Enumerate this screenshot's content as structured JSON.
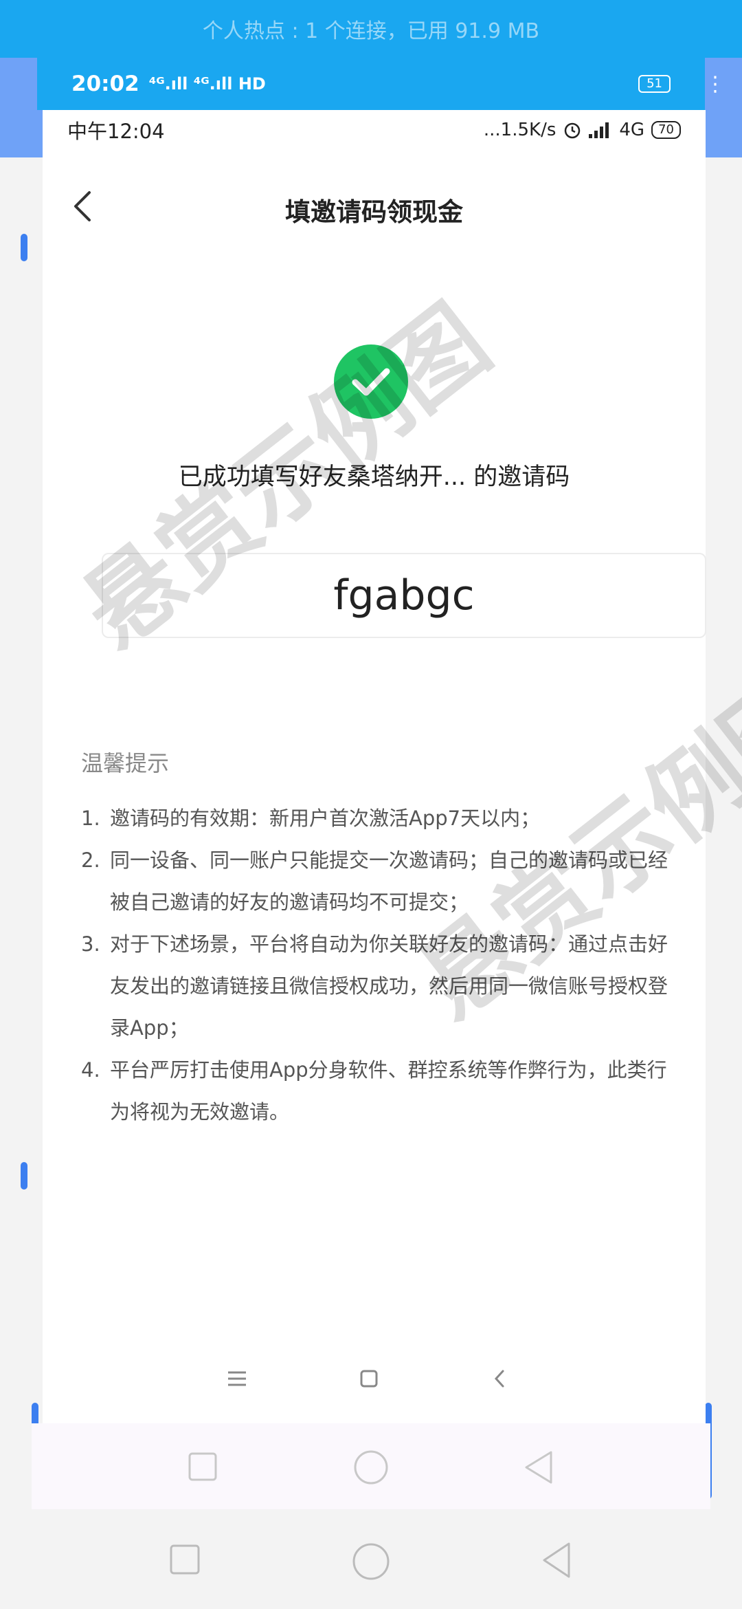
{
  "outer_status": {
    "hotspot_text": "个人热点 : 1 个连接，已用 91.9 MB"
  },
  "middle_status": {
    "time": "20:02",
    "signal_text": "⁴ᴳ.ıll ⁴ᴳ.ıll HD",
    "battery": "51",
    "more": "⋮"
  },
  "inner_status": {
    "time": "中午12:04",
    "speed": "...1.5K/s",
    "network": "4G",
    "battery": "70"
  },
  "header": {
    "title": "填邀请码领现金"
  },
  "success": {
    "message": "已成功填写好友桑塔纳开... 的邀请码",
    "code": "fgabgc"
  },
  "tips": {
    "title": "温馨提示",
    "items": [
      {
        "num": "1.",
        "text": "邀请码的有效期：新用户首次激活App7天以内；"
      },
      {
        "num": "2.",
        "text": "同一设备、同一账户只能提交一次邀请码；自己的邀请码或已经被自己邀请的好友的邀请码均不可提交；"
      },
      {
        "num": "3.",
        "text": "对于下述场景，平台将自动为你关联好友的邀请码：通过点击好友发出的邀请链接且微信授权成功，然后用同一微信账号授权登录App；"
      },
      {
        "num": "4.",
        "text": "平台严厉打击使用App分身软件、群控系统等作弊行为，此类行为将视为无效邀请。"
      }
    ]
  },
  "watermark": {
    "text": "悬赏示例图"
  },
  "icons": {
    "back": "chevron-left-icon",
    "success": "check-circle-icon",
    "menu": "menu-icon",
    "home": "home-icon",
    "recent": "square-icon",
    "back_nav": "triangle-back-icon"
  },
  "colors": {
    "success_green": "#1fc463",
    "hotspot_blue": "#1aa7f0"
  }
}
